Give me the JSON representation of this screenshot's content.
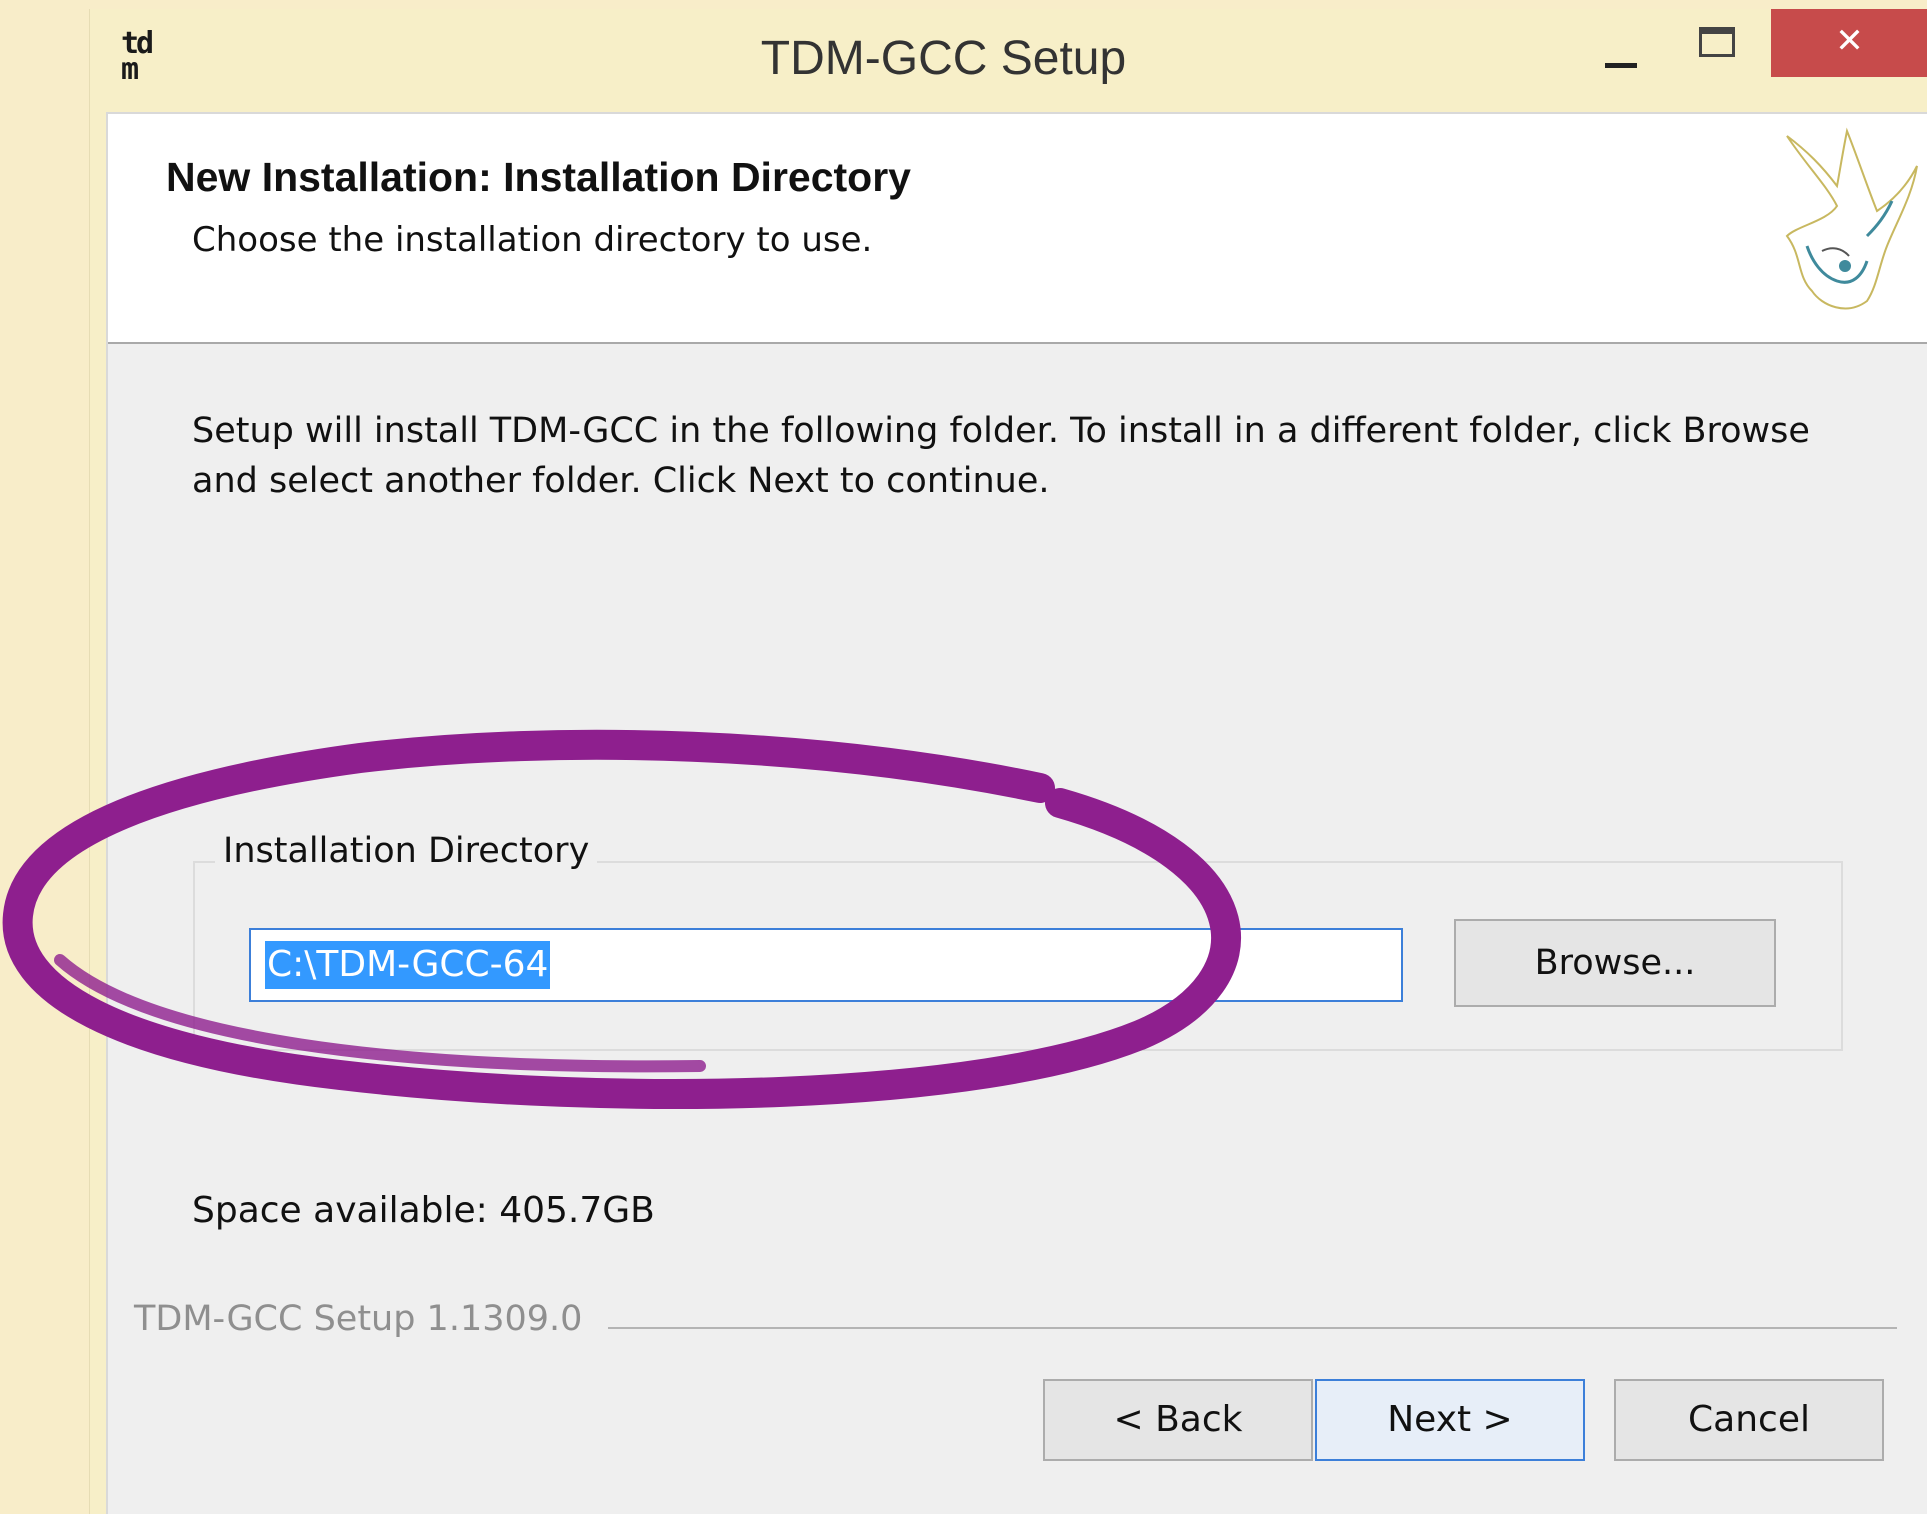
{
  "window": {
    "app_icon_text": "td\nm",
    "title": "TDM-GCC Setup",
    "close_glyph": "✕"
  },
  "header": {
    "title": "New Installation: Installation Directory",
    "subtitle": "Choose the installation directory to use."
  },
  "body": {
    "description": "Setup will install TDM-GCC in the following folder. To install in a different folder, click Browse and select another folder. Click Next to continue.",
    "group_label": "Installation Directory",
    "directory_value": "C:\\TDM-GCC-64",
    "browse_label": "Browse...",
    "space_available": "Space available: 405.7GB"
  },
  "footer": {
    "version": "TDM-GCC Setup 1.1309.0",
    "back_label": "< Back",
    "next_label": "Next >",
    "cancel_label": "Cancel"
  },
  "colors": {
    "annotation": "#8e1f8e",
    "selection": "#3399ff",
    "close_button": "#c74b4b"
  }
}
